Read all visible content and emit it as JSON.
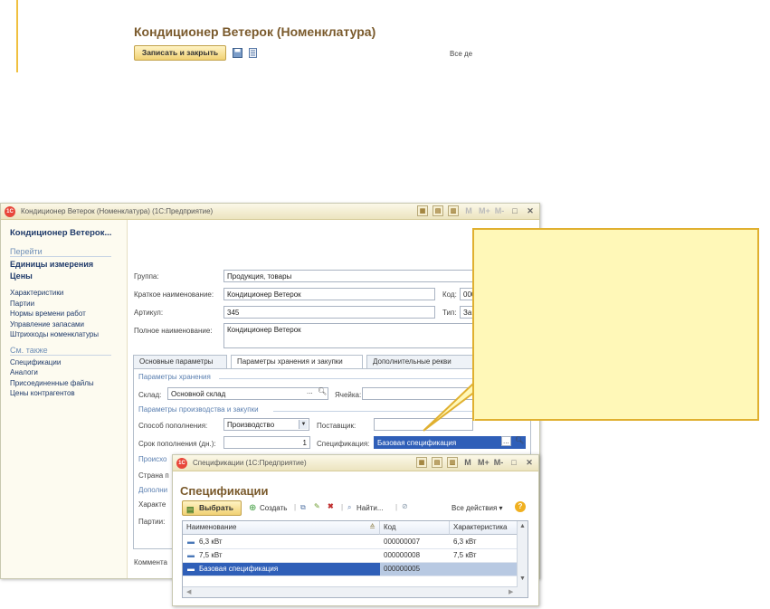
{
  "main_window": {
    "title": "Кондиционер Ветерок (Номенклатура) (1С:Предприятие)",
    "form_title": "Кондиционер Ветерок (Номенклатура)",
    "sidebar": {
      "title": "Кондиционер Ветерок...",
      "goto_section": "Перейти",
      "goto_items": [
        "Единицы измерения",
        "Цены"
      ],
      "items": [
        "Характеристики",
        "Партии",
        "Нормы времени работ",
        "Управление запасами",
        "Штрихкоды номенклатуры"
      ],
      "see_also_section": "См. также",
      "see_also_items": [
        "Спецификации",
        "Аналоги",
        "Присоединенные файлы",
        "Цены контрагентов"
      ]
    },
    "toolbar": {
      "save_close": "Записать и закрыть",
      "all_actions": "Все де"
    },
    "fields": {
      "group_label": "Группа:",
      "group_value": "Продукция, товары",
      "short_name_label": "Краткое наименование:",
      "short_name_value": "Кондиционер Ветерок",
      "code_label": "Код:",
      "code_value": "000",
      "article_label": "Артикул:",
      "article_value": "345",
      "type_label": "Тип:",
      "type_value": "За",
      "full_name_label": "Полное наименование:",
      "full_name_value": "Кондиционер Ветерок"
    },
    "tabs": [
      "Основные параметры",
      "Параметры хранения и закупки",
      "Дополнительные рекви"
    ],
    "active_tab_index": 1,
    "tab_content": {
      "storage_group": "Параметры хранения",
      "warehouse_label": "Склад:",
      "warehouse_value": "Основной склад",
      "cell_label": "Ячейка:",
      "production_group": "Параметры производства и закупки",
      "replenish_label": "Способ пополнения:",
      "replenish_value": "Производство",
      "supplier_label": "Поставщик:",
      "term_label": "Срок пополнения (дн.):",
      "term_value": "1",
      "spec_label": "Спецификация:",
      "spec_value": "Базовая спецификация",
      "origin_label": "Происхо",
      "country_label": "Страна п",
      "extra_group": "Дополни",
      "character_label": "Характе",
      "lots_label": "Партии:"
    },
    "comment_label": "Коммента"
  },
  "spec_window": {
    "title": "Спецификации (1С:Предприятие)",
    "form_title": "Спецификации",
    "toolbar": {
      "choose": "Выбрать",
      "create": "Создать",
      "find": "Найти...",
      "all_actions": "Все действия ▾"
    },
    "columns": [
      "Наименование",
      "Код",
      "Характеристика"
    ],
    "rows": [
      {
        "name": "6,3 кВт",
        "code": "000000007",
        "char": "6,3 кВт"
      },
      {
        "name": "7,5 кВт",
        "code": "000000008",
        "char": "7,5 кВт"
      },
      {
        "name": "Базовая спецификация",
        "code": "000000005",
        "char": ""
      }
    ],
    "selected_row_index": 2
  },
  "titlebar_buttons": {
    "m": "M",
    "mplus": "M+",
    "mminus": "M-",
    "restore": "□",
    "close": "✕"
  },
  "colors": {
    "accent_title": "#7a5a2c",
    "callout_bg": "#fff8b8",
    "callout_border": "#e0b030",
    "selection": "#2f5fb8"
  }
}
